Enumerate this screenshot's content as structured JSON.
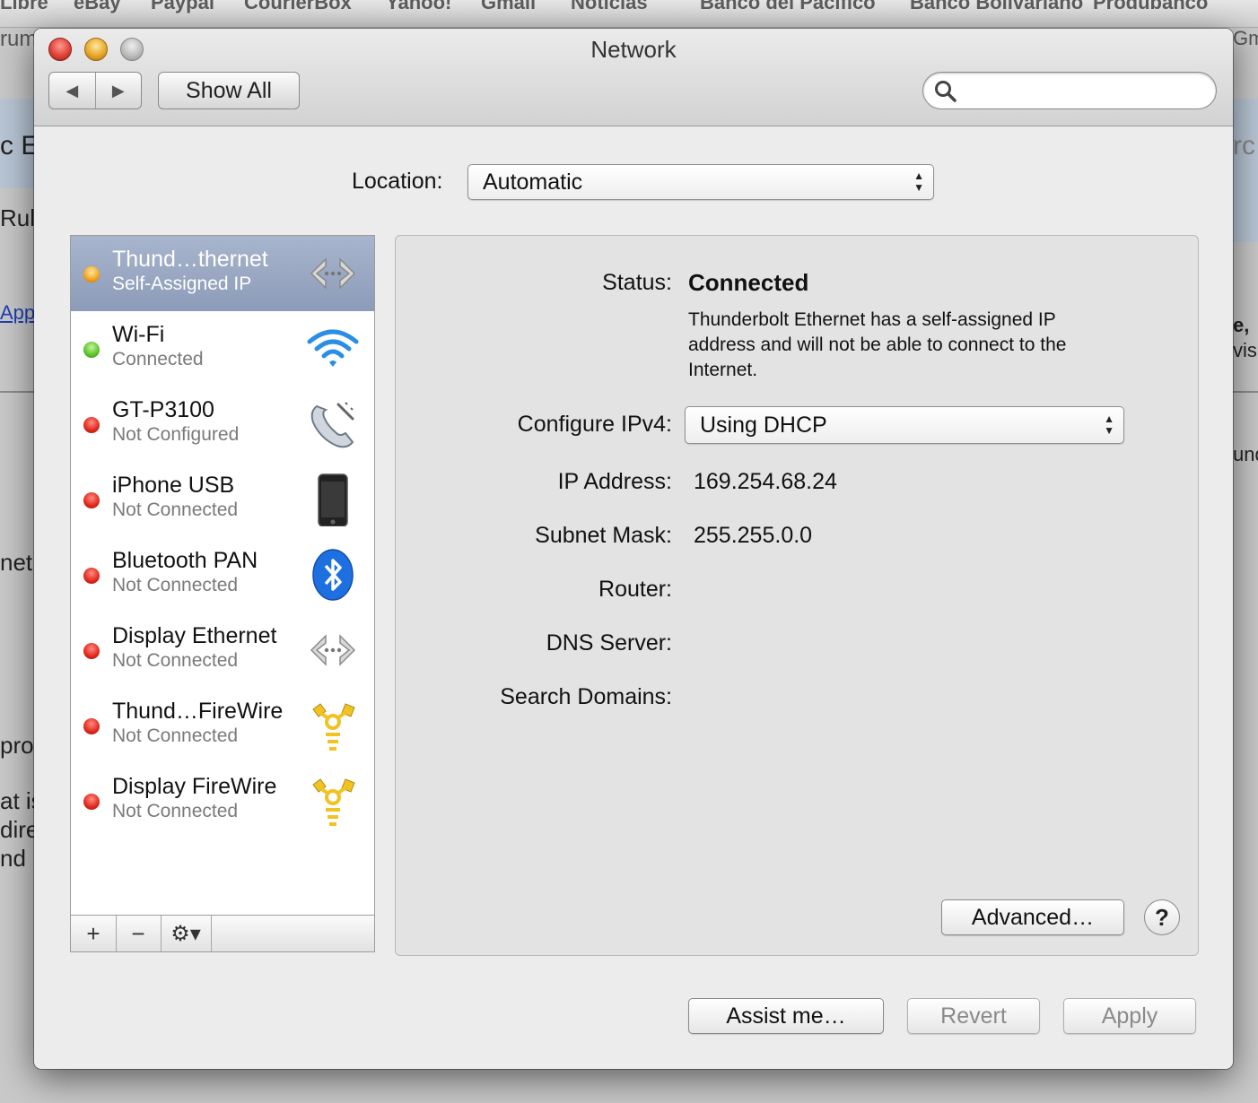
{
  "background": {
    "bookmarks": [
      "Libre",
      "eBay",
      "Paypal",
      "CourierBox",
      "Yahoo!",
      "Gmail",
      "Noticias",
      "Banco del Pacifico",
      "Banco Bolivariano",
      "Produbanco"
    ],
    "fragments_left": [
      "rum",
      "c E",
      "Rule",
      "Appl",
      "net",
      "pro",
      "at is",
      "dire",
      "nd"
    ],
    "fragments_right": [
      "Gm",
      "rc",
      "e, ",
      "visi",
      "und"
    ]
  },
  "window": {
    "title": "Network",
    "show_all_label": "Show All",
    "back_glyph": "◀",
    "forward_glyph": "▶",
    "search_placeholder": "",
    "search_icon": "magnifier-icon"
  },
  "location": {
    "label": "Location:",
    "value": "Automatic"
  },
  "services": [
    {
      "name": "Thund…thernet",
      "status": "Self-Assigned IP",
      "dot": "yellow",
      "icon": "ethernet-arrows-icon",
      "selected": true
    },
    {
      "name": "Wi-Fi",
      "status": "Connected",
      "dot": "green",
      "icon": "wifi-icon",
      "selected": false
    },
    {
      "name": "GT-P3100",
      "status": "Not Configured",
      "dot": "red",
      "icon": "phone-handset-icon",
      "selected": false
    },
    {
      "name": "iPhone USB",
      "status": "Not Connected",
      "dot": "red",
      "icon": "iphone-icon",
      "selected": false
    },
    {
      "name": "Bluetooth PAN",
      "status": "Not Connected",
      "dot": "red",
      "icon": "bluetooth-icon",
      "selected": false
    },
    {
      "name": "Display Ethernet",
      "status": "Not Connected",
      "dot": "red",
      "icon": "ethernet-arrows-icon",
      "selected": false
    },
    {
      "name": "Thund…FireWire",
      "status": "Not Connected",
      "dot": "red",
      "icon": "firewire-icon",
      "selected": false
    },
    {
      "name": "Display FireWire",
      "status": "Not Connected",
      "dot": "red",
      "icon": "firewire-icon",
      "selected": false
    }
  ],
  "sidebar_footer": {
    "add": "+",
    "remove": "−",
    "gear": "⚙▾"
  },
  "detail": {
    "status_label": "Status:",
    "status_value": "Connected",
    "status_description": "Thunderbolt Ethernet has a self-assigned IP address and will not be able to connect to the Internet.",
    "configure_label": "Configure IPv4:",
    "configure_value": "Using DHCP",
    "ip_label": "IP Address:",
    "ip_value": "169.254.68.24",
    "subnet_label": "Subnet Mask:",
    "subnet_value": "255.255.0.0",
    "router_label": "Router:",
    "dns_label": "DNS Server:",
    "search_domains_label": "Search Domains:",
    "advanced_label": "Advanced…",
    "help_label": "?"
  },
  "footer": {
    "assist_label": "Assist me…",
    "revert_label": "Revert",
    "apply_label": "Apply"
  },
  "colors": {
    "selection": "#9aa8c3",
    "status_red": "#e1261b",
    "status_green": "#58c22a",
    "status_yellow": "#f2a21a"
  }
}
